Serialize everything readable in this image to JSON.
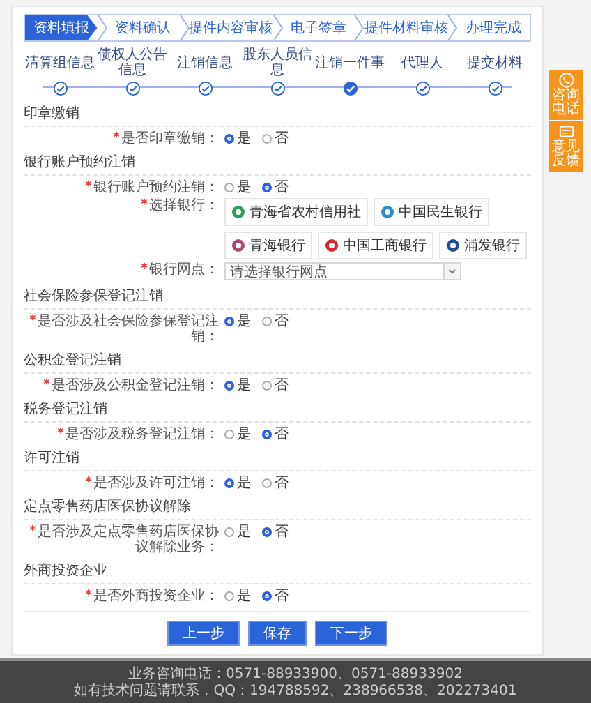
{
  "steps": [
    {
      "label": "资料填报",
      "selected": true
    },
    {
      "label": "资料确认",
      "selected": false
    },
    {
      "label": "提件内容审核",
      "selected": false
    },
    {
      "label": "电子签章",
      "selected": false
    },
    {
      "label": "提件材料审核",
      "selected": false
    },
    {
      "label": "办理完成",
      "selected": false
    }
  ],
  "substeps": [
    {
      "label": "清算组信息",
      "selected": false
    },
    {
      "label": "债权人公告信息",
      "selected": false
    },
    {
      "label": "注销信息",
      "selected": false
    },
    {
      "label": "股东人员信息",
      "selected": false
    },
    {
      "label": "注销一件事",
      "selected": true
    },
    {
      "label": "代理人",
      "selected": false
    },
    {
      "label": "提交材料",
      "selected": false
    }
  ],
  "sections": [
    {
      "title": "印章缴销",
      "fields": [
        {
          "kind": "radio",
          "label": "是否印章缴销：",
          "required": true,
          "options": [
            {
              "label": "是",
              "selected": true
            },
            {
              "label": "否",
              "selected": false
            }
          ]
        }
      ]
    },
    {
      "title": "银行账户预约注销",
      "fields": [
        {
          "kind": "radio",
          "label": "银行账户预约注销：",
          "required": true,
          "options": [
            {
              "label": "是",
              "selected": false
            },
            {
              "label": "否",
              "selected": true
            }
          ]
        },
        {
          "kind": "banks",
          "label": "选择银行：",
          "required": true,
          "banks": [
            {
              "name": "青海省农村信用社",
              "color": "#2e9e5a"
            },
            {
              "name": "中国民生银行",
              "color": "#2a8fc9"
            },
            {
              "name": "青海银行",
              "color": "#b0497a"
            },
            {
              "name": "中国工商银行",
              "color": "#d3272f"
            },
            {
              "name": "浦发银行",
              "color": "#1f4b9a"
            }
          ]
        },
        {
          "kind": "select",
          "label": "银行网点：",
          "required": true,
          "placeholder": "请选择银行网点"
        }
      ]
    },
    {
      "title": "社会保险参保登记注销",
      "fields": [
        {
          "kind": "radio",
          "label": "是否涉及社会保险参保登记注销：",
          "required": true,
          "options": [
            {
              "label": "是",
              "selected": true
            },
            {
              "label": "否",
              "selected": false
            }
          ]
        }
      ]
    },
    {
      "title": "公积金登记注销",
      "fields": [
        {
          "kind": "radio",
          "label": "是否涉及公积金登记注销：",
          "required": true,
          "options": [
            {
              "label": "是",
              "selected": true
            },
            {
              "label": "否",
              "selected": false
            }
          ]
        }
      ]
    },
    {
      "title": "税务登记注销",
      "fields": [
        {
          "kind": "radio",
          "label": "是否涉及税务登记注销：",
          "required": true,
          "options": [
            {
              "label": "是",
              "selected": false
            },
            {
              "label": "否",
              "selected": true
            }
          ]
        }
      ]
    },
    {
      "title": "许可注销",
      "fields": [
        {
          "kind": "radio",
          "label": "是否涉及许可注销：",
          "required": true,
          "options": [
            {
              "label": "是",
              "selected": true
            },
            {
              "label": "否",
              "selected": false
            }
          ]
        }
      ]
    },
    {
      "title": "定点零售药店医保协议解除",
      "fields": [
        {
          "kind": "radio",
          "label": "是否涉及定点零售药店医保协议解除业务：",
          "required": true,
          "options": [
            {
              "label": "是",
              "selected": false
            },
            {
              "label": "否",
              "selected": true
            }
          ]
        }
      ]
    },
    {
      "title": "外商投资企业",
      "fields": [
        {
          "kind": "radio",
          "label": "是否外商投资企业：",
          "required": true,
          "options": [
            {
              "label": "是",
              "selected": false
            },
            {
              "label": "否",
              "selected": true
            }
          ]
        }
      ]
    }
  ],
  "buttons": [
    "上一步",
    "保存",
    "下一步"
  ],
  "side_tools": [
    {
      "kind": "phone",
      "label": "咨询电话"
    },
    {
      "kind": "feedback",
      "label": "意见反馈"
    }
  ],
  "footer": [
    "业务咨询电话：0571-88933900、0571-88933902",
    "如有技术问题请联系，QQ：194788592、238966538、202273401"
  ]
}
